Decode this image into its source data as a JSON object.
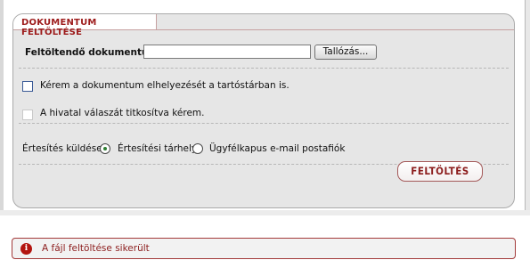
{
  "panel": {
    "title": "DOKUMENTUM FELTÖLTÉSE"
  },
  "upload_row": {
    "label": "Feltöltendő dokumentum:",
    "file_value": "",
    "browse_label": "Tallózás..."
  },
  "options": {
    "place_in_storage": {
      "label": "Kérem a dokumentum elhelyezését a tartóstárban is.",
      "checked": false
    },
    "confidential_reply": {
      "label": "A hivatal válaszát titkosítva kérem.",
      "checked": false,
      "enabled": false
    }
  },
  "notification": {
    "label": "Értesítés küldése:",
    "choices": [
      {
        "label": "Értesítési tárhely",
        "selected": true
      },
      {
        "label": "Ügyfélkapus e-mail postafiók",
        "selected": false
      }
    ]
  },
  "actions": {
    "upload_label": "FELTÖLTÉS"
  },
  "status": {
    "icon": "info-icon",
    "message": "A fájl feltöltése sikerült"
  },
  "colors": {
    "accent": "#9d1b1b",
    "panel_bg": "#e6e6e6",
    "radio_selected": "#2e7d32"
  }
}
